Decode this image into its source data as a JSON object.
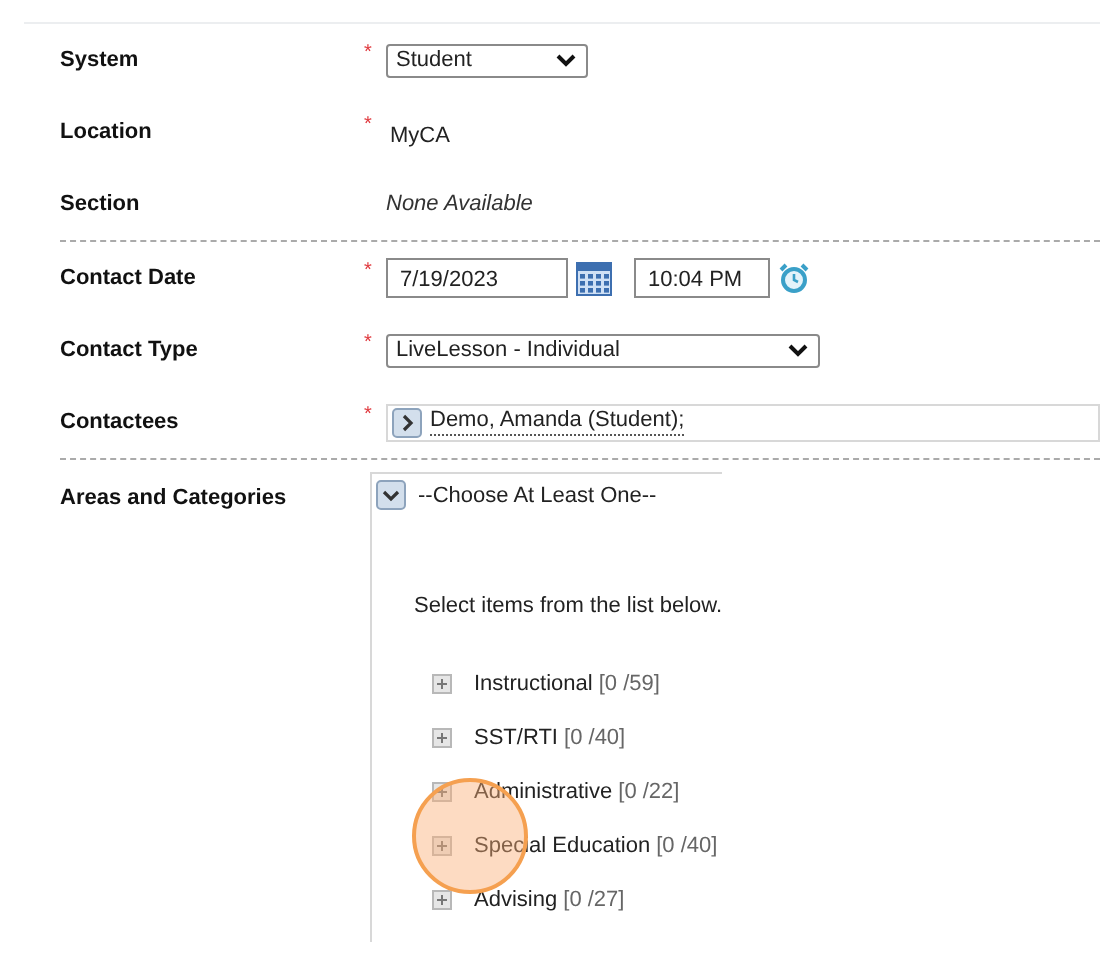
{
  "sections": [
    [
      {
        "label": "System",
        "kind": "select",
        "required_mark": "*",
        "value": "Student"
      },
      {
        "label": "Location",
        "kind": "text",
        "required_mark": "*",
        "value": "MyCA"
      },
      {
        "label": "Section",
        "kind": "note",
        "value": "None Available"
      }
    ],
    [
      {
        "label": "Contact Date",
        "kind": "datetime",
        "required_mark": "*",
        "value": "7/19/2023",
        "time": "10:04 PM"
      },
      {
        "label": "Contact Type",
        "kind": "select",
        "required_mark": "*",
        "value": "LiveLesson - Individual"
      },
      {
        "label": "Contactees",
        "kind": "picker",
        "required_mark": "*",
        "value": "Demo, Amanda (Student);"
      }
    ],
    [
      {
        "label": "Areas and Categories",
        "kind": "tree",
        "value": "--Choose At Least One--",
        "hint": "Select items from the list below.",
        "items": [
          {
            "label": "Instructional",
            "count": "[0 /59]"
          },
          {
            "label": "SST/RTI",
            "count": "[0 /40]"
          },
          {
            "label": "Administrative",
            "count": "[0 /22]"
          },
          {
            "label": "Special Education",
            "count": "[0 /40]"
          },
          {
            "label": "Advising",
            "count": "[0 /27]"
          }
        ]
      }
    ]
  ]
}
